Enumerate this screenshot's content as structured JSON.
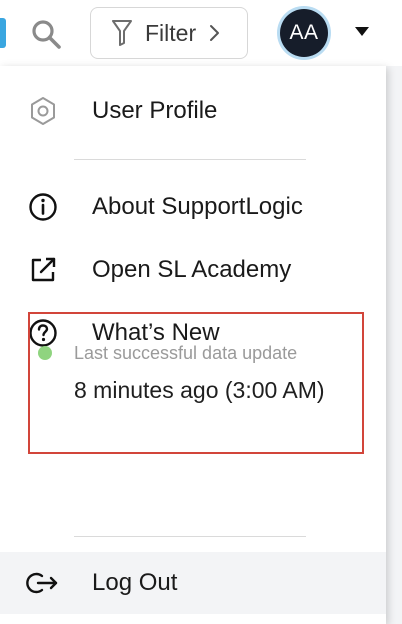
{
  "header": {
    "filter_label": "Filter",
    "avatar_initials": "AA"
  },
  "menu": {
    "user_profile": "User Profile",
    "about": "About SupportLogic",
    "academy": "Open SL Academy",
    "whats_new": "What’s New",
    "logout": "Log Out"
  },
  "status": {
    "label": "Last successful data update",
    "value": "8 minutes ago (3:00 AM)",
    "dot_color": "#8fd47f"
  },
  "colors": {
    "accent": "#3aa6e0",
    "highlight_border": "#d2453a",
    "avatar_bg": "#161d2a"
  },
  "icons": {
    "search": "search-icon",
    "filter": "funnel-icon",
    "chevron": "chevron-right-icon",
    "profile": "hexagon-icon",
    "about": "info-icon",
    "academy": "external-link-icon",
    "whats_new": "help-icon",
    "logout": "logout-icon"
  }
}
